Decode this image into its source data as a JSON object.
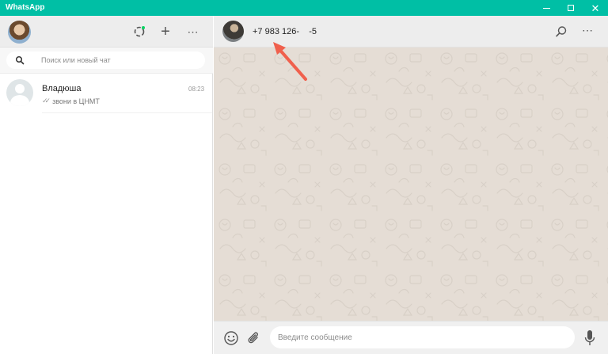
{
  "window": {
    "title": "WhatsApp",
    "minimize_icon": "minimize-icon",
    "maximize_icon": "maximize-icon",
    "close_icon": "close-icon",
    "close_glyph": "✕"
  },
  "sidebar": {
    "header": {
      "status_icon": "status-icon",
      "new_chat_glyph": "+",
      "menu_glyph": "⋯"
    },
    "search": {
      "placeholder": "Поиск или новый чат"
    },
    "chats": [
      {
        "name": "Владюша",
        "time": "08:23",
        "ticks": "✓✓",
        "preview": "звони в ЦНМТ"
      }
    ]
  },
  "conversation": {
    "contact_name": "+7 983 126-    -5",
    "menu_glyph": "⋯",
    "composer": {
      "placeholder": "Введите сообщение"
    }
  },
  "colors": {
    "accent": "#00bfa5",
    "header_bg": "#ededed",
    "chat_bg": "#e5ddd5",
    "annotation_arrow": "#f0604d",
    "status_dot": "#09d261"
  }
}
